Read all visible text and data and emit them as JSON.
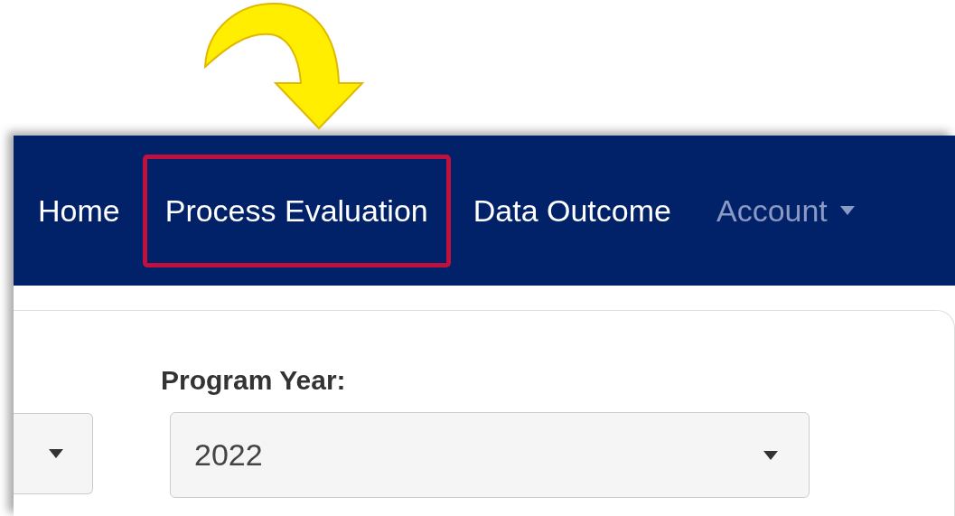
{
  "navbar": {
    "items": [
      {
        "label": "Home",
        "kind": "link",
        "highlighted": false
      },
      {
        "label": "Process Evaluation",
        "kind": "link",
        "highlighted": true
      },
      {
        "label": "Data Outcome",
        "kind": "link",
        "highlighted": false
      },
      {
        "label": "Account",
        "kind": "dropdown",
        "highlighted": false
      }
    ]
  },
  "filters": [
    {
      "kind": "partial"
    },
    {
      "kind": "full",
      "label": "Program Year:",
      "value": "2022"
    }
  ]
}
